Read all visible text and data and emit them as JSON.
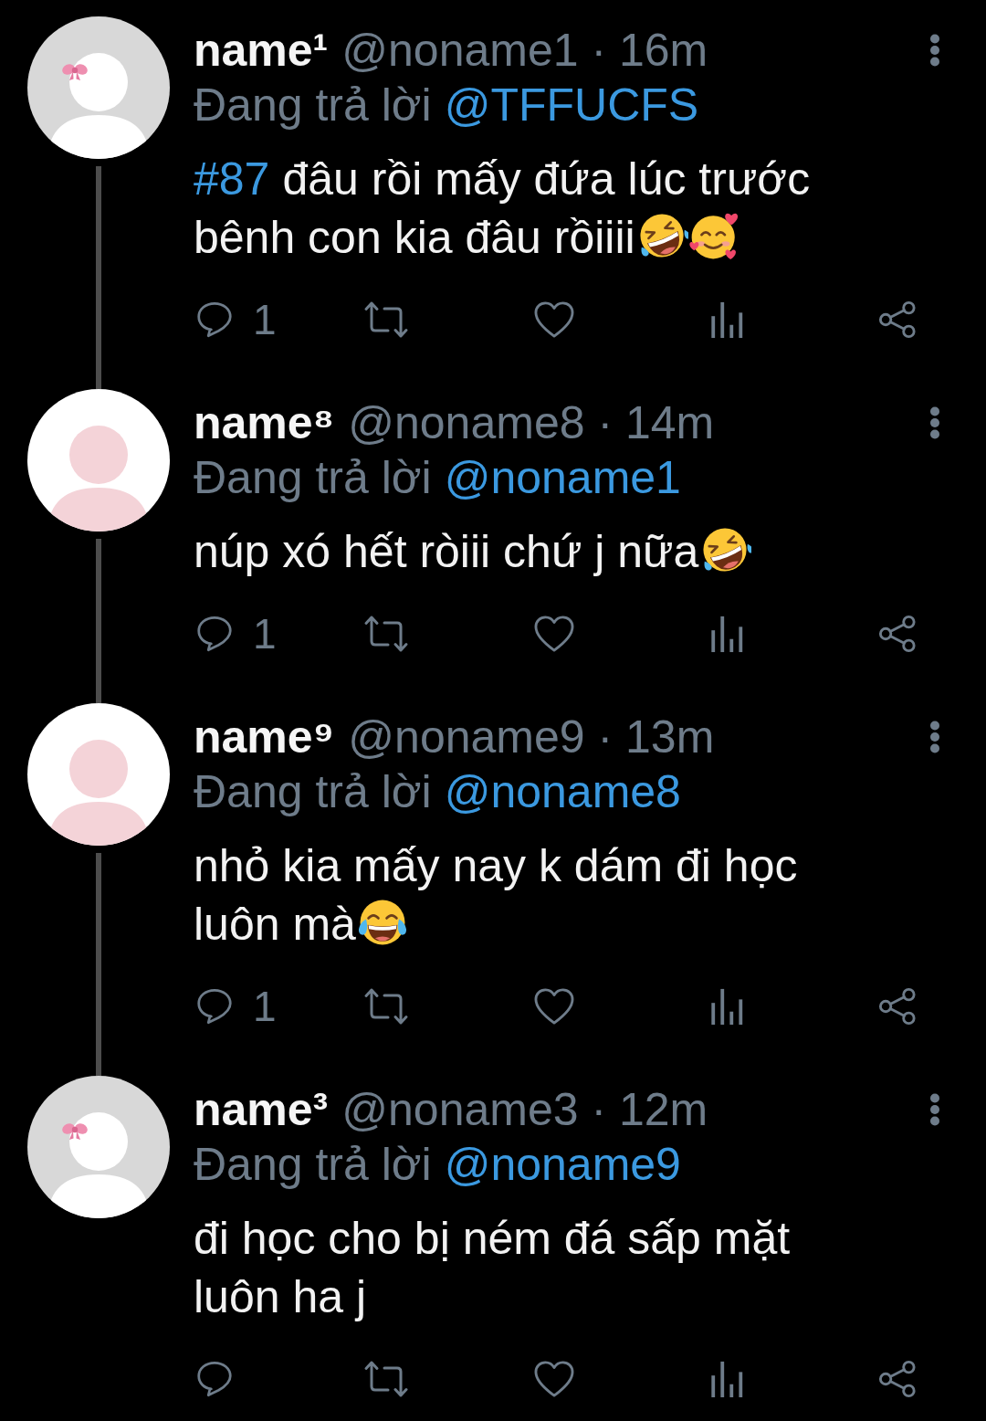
{
  "tweets": [
    {
      "avatar": {
        "kind": "bow"
      },
      "name": "name¹",
      "handle_time": "@noname1 · 16m",
      "reply_label": "Đang trả lời",
      "reply_to": "@TFFUCFS",
      "body": [
        {
          "kind": "hashtag",
          "text": "#87"
        },
        {
          "kind": "text",
          "text": "đâu rồi mấy đứa lúc trước bênh con kia đâu rồiiii"
        },
        {
          "kind": "rofl"
        },
        {
          "kind": "hearts"
        }
      ],
      "reply_count": "1",
      "thread_line": true
    },
    {
      "avatar": {
        "kind": "pink"
      },
      "name": "name⁸",
      "handle_time": "@noname8 · 14m",
      "reply_label": "Đang trả lời",
      "reply_to": "@noname1",
      "body": [
        {
          "kind": "text",
          "text": "núp xó hết ròiii chứ j nữa"
        },
        {
          "kind": "rofl"
        }
      ],
      "reply_count": "1",
      "thread_line": true
    },
    {
      "avatar": {
        "kind": "pink"
      },
      "name": "name⁹",
      "handle_time": "@noname9 · 13m",
      "reply_label": "Đang trả lời",
      "reply_to": "@noname8",
      "body": [
        {
          "kind": "text",
          "text": "nhỏ kia mấy nay k dám đi học luôn mà"
        },
        {
          "kind": "joy"
        }
      ],
      "reply_count": "1",
      "thread_line": true
    },
    {
      "avatar": {
        "kind": "bow"
      },
      "name": "name³",
      "handle_time": "@noname3 · 12m",
      "reply_label": "Đang trả lời",
      "reply_to": "@noname9",
      "body": [
        {
          "kind": "text",
          "text": "đi học cho bị ném đá sấp mặt luôn ha j"
        }
      ],
      "thread_line": false
    }
  ]
}
